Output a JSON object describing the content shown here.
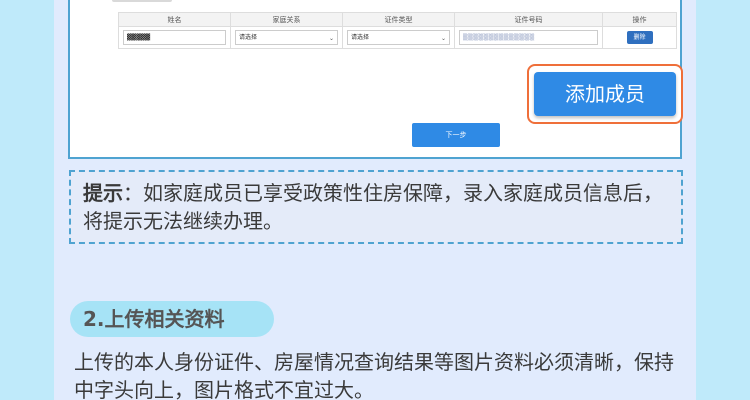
{
  "table": {
    "headers": [
      "姓名",
      "家庭关系",
      "证件类型",
      "证件号码",
      "操作"
    ],
    "row": {
      "name_value": "▓▓▓▓▓",
      "relation_value": "请选择",
      "doc_type_value": "请选择",
      "id_value": "▒▒▒▒▒▒▒▒▒▒▒▒▒▒",
      "delete_label": "删除"
    }
  },
  "buttons": {
    "add_member": "添加成员",
    "next": "下一步"
  },
  "tip": {
    "label": "提示",
    "text": "：如家庭成员已享受政策性住房保障，录入家庭成员信息后，将提示无法继续办理。"
  },
  "section": {
    "title": "2.上传相关资料",
    "body": "上传的本人身份证件、房屋情况查询结果等图片资料必须清晰，保持中字头向上，图片格式不宜过大。"
  }
}
